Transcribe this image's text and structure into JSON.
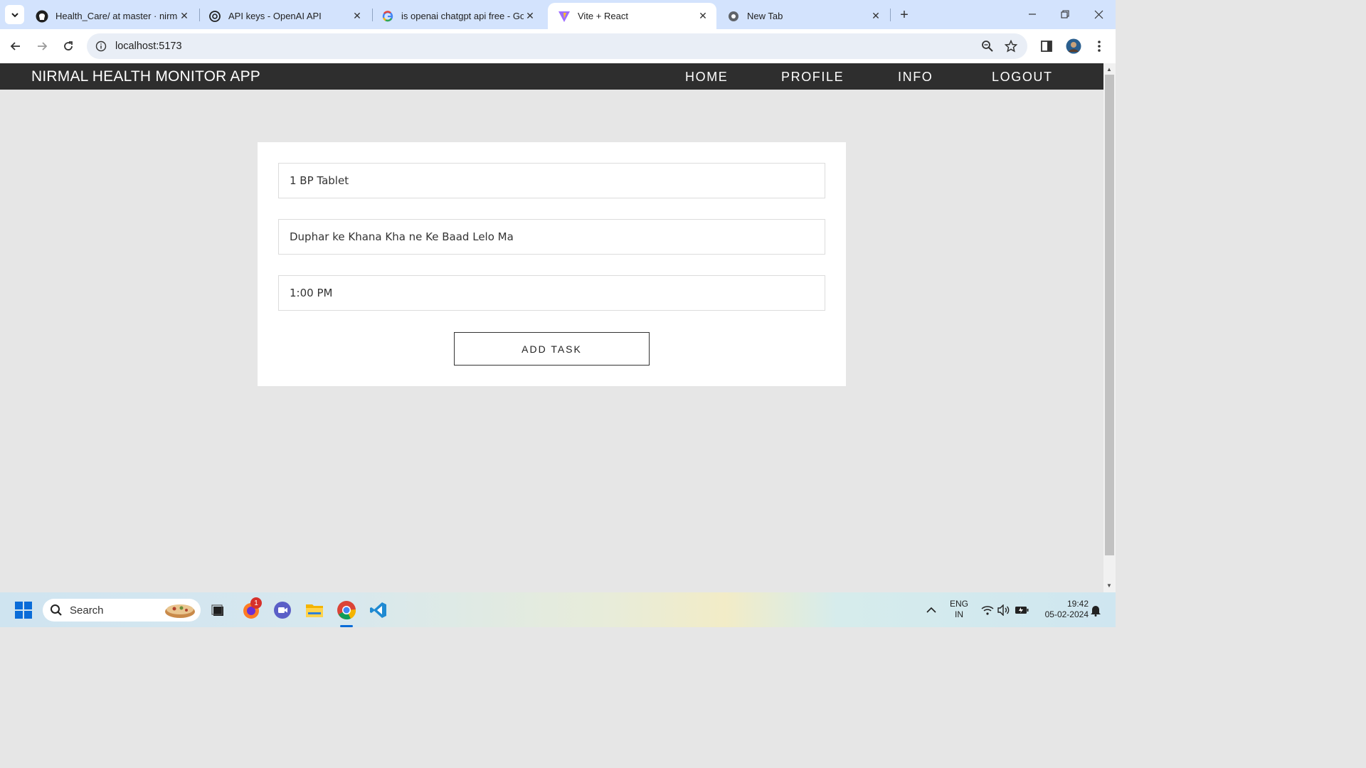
{
  "browser": {
    "tabs": [
      {
        "title": "Health_Care/ at master · nirmalj",
        "icon": "github-icon",
        "active": false
      },
      {
        "title": "API keys - OpenAI API",
        "icon": "openai-icon",
        "active": false
      },
      {
        "title": "is openai chatgpt api free - Goo",
        "icon": "google-icon",
        "active": false
      },
      {
        "title": "Vite + React",
        "icon": "vite-icon",
        "active": true
      },
      {
        "title": "New Tab",
        "icon": "chrome-icon",
        "active": false
      }
    ],
    "url": "localhost:5173"
  },
  "app": {
    "brand": "NIRMAL HEALTH MONITOR APP",
    "nav": {
      "home": "HOME",
      "profile": "PROFILE",
      "info": "INFO",
      "logout": "LOGOUT"
    },
    "form": {
      "task_name": "1 BP Tablet",
      "task_description": "Duphar ke Khana Kha ne Ke Baad Lelo Ma",
      "task_time": "1:00 PM",
      "submit_label": "ADD TASK"
    }
  },
  "taskbar": {
    "search_label": "Search",
    "notification_badge": "1",
    "language_line1": "ENG",
    "language_line2": "IN",
    "time": "19:42",
    "date": "05-02-2024"
  },
  "colors": {
    "app_bar": "#2e2e2e",
    "page_bg": "#e6e6e6",
    "tabstrip": "#d3e3fd"
  }
}
